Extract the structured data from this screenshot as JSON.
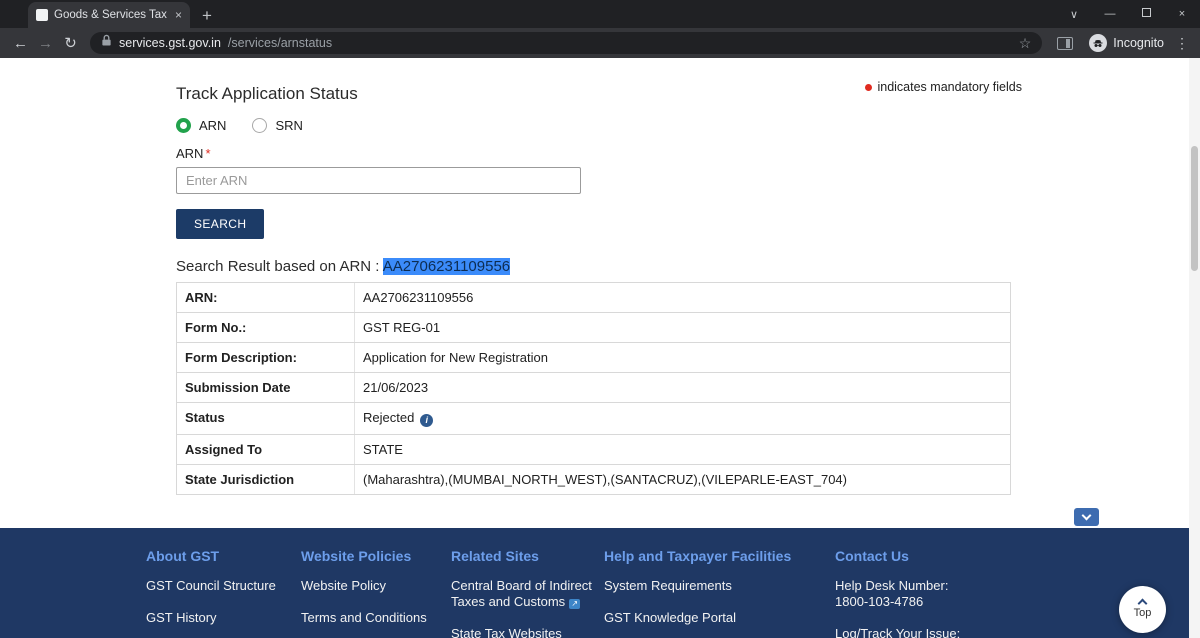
{
  "browser": {
    "tab_title": "Goods & Services Tax (GST) | Trac",
    "url_host": "services.gst.gov.in",
    "url_path": "/services/arnstatus",
    "incognito_label": "Incognito"
  },
  "page": {
    "title": "Track Application Status",
    "mandatory_note": "indicates mandatory fields",
    "radios": {
      "arn": "ARN",
      "srn": "SRN"
    },
    "arn_field": {
      "label": "ARN",
      "required_mark": "*",
      "placeholder": "Enter ARN"
    },
    "search_button": "SEARCH",
    "result": {
      "prefix": "Search Result based on ARN : ",
      "arn": "AA2706231109556"
    },
    "table_rows": [
      {
        "label": "ARN:",
        "value": "AA2706231109556"
      },
      {
        "label": "Form No.:",
        "value": "GST REG-01"
      },
      {
        "label": "Form Description:",
        "value": "Application for New Registration"
      },
      {
        "label": "Submission Date",
        "value": "21/06/2023"
      },
      {
        "label": "Status",
        "value": "Rejected",
        "info_icon": true
      },
      {
        "label": "Assigned To",
        "value": "STATE"
      },
      {
        "label": "State Jurisdiction",
        "value": "(Maharashtra),(MUMBAI_NORTH_WEST),(SANTACRUZ),(VILEPARLE-EAST_704)"
      }
    ]
  },
  "footer": {
    "columns": [
      {
        "heading": "About GST",
        "links": [
          {
            "text": "GST Council Structure"
          },
          {
            "text": "GST History"
          }
        ]
      },
      {
        "heading": "Website Policies",
        "links": [
          {
            "text": "Website Policy"
          },
          {
            "text": "Terms and Conditions"
          }
        ]
      },
      {
        "heading": "Related Sites",
        "links": [
          {
            "text": "Central Board of Indirect Taxes and Customs",
            "external": true
          },
          {
            "text": "State Tax Websites"
          }
        ]
      },
      {
        "heading": "Help and Taxpayer Facilities",
        "links": [
          {
            "text": "System Requirements"
          },
          {
            "text": "GST Knowledge Portal"
          }
        ]
      },
      {
        "heading": "Contact Us",
        "links": [
          {
            "text": "Help Desk Number: 1800-103-4786"
          },
          {
            "text": "Log/Track Your Issue:"
          }
        ]
      }
    ]
  },
  "floating": {
    "top_button": "Top"
  }
}
